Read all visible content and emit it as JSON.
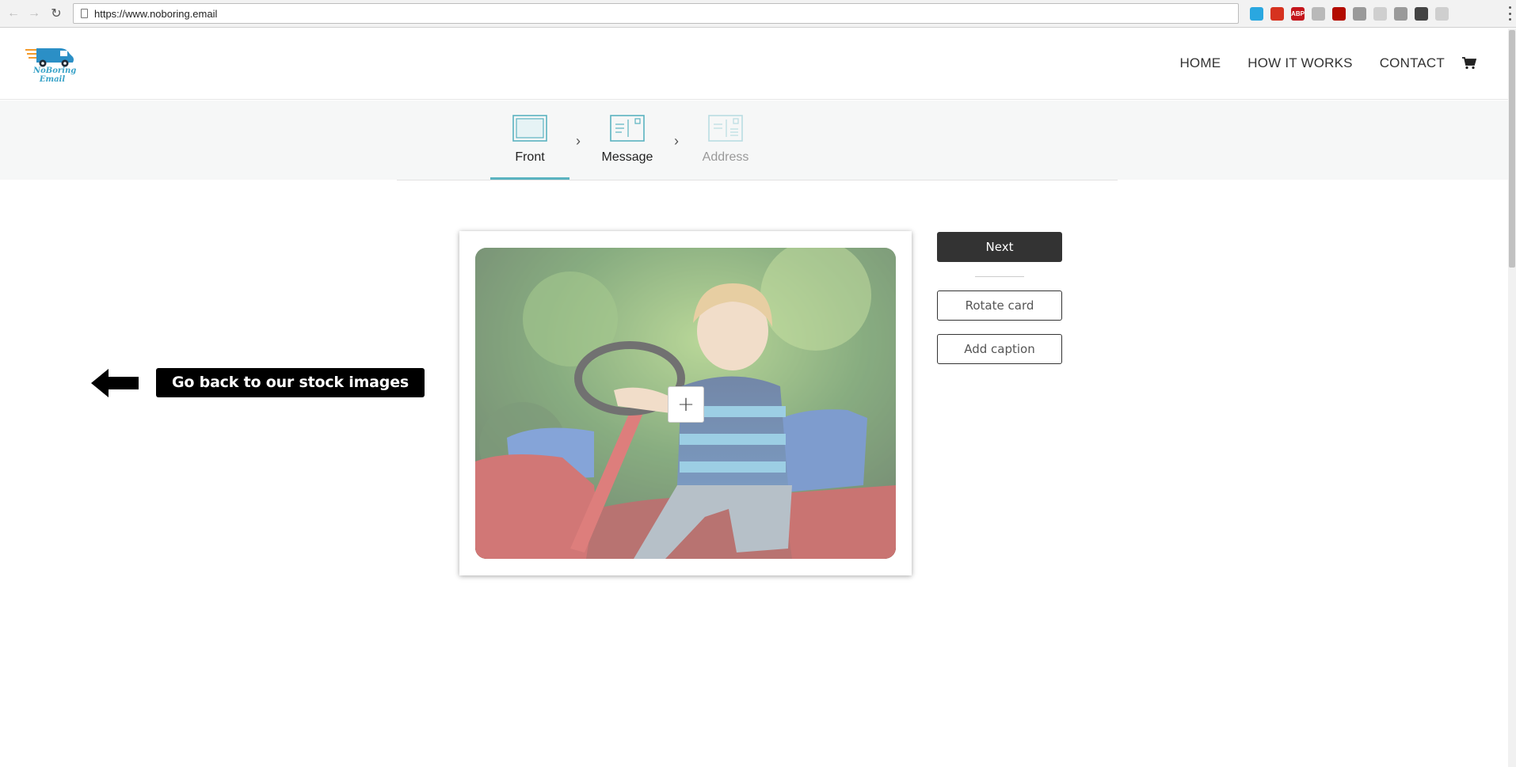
{
  "browser": {
    "url": "https://www.noboring.email",
    "extensions": [
      {
        "name": "sync-icon",
        "color": "#2aa7e0"
      },
      {
        "name": "flash-icon",
        "color": "#d6321f"
      },
      {
        "name": "adblock-icon",
        "color": "#c4161c",
        "label": "ABP"
      },
      {
        "name": "camera-icon",
        "color": "#b9b9b9"
      },
      {
        "name": "acrobat-icon",
        "color": "#b30b00"
      },
      {
        "name": "feather-icon",
        "color": "#9a9a9a"
      },
      {
        "name": "pen-icon",
        "color": "#cfcfcf"
      },
      {
        "name": "magnifier-icon",
        "color": "#9a9a9a"
      },
      {
        "name": "block-icon",
        "color": "#444444"
      },
      {
        "name": "chat-icon",
        "color": "#cfcfcf"
      }
    ]
  },
  "header": {
    "logo_text": "NoBoring Email",
    "nav": [
      {
        "label": "HOME"
      },
      {
        "label": "HOW IT WORKS"
      },
      {
        "label": "CONTACT"
      }
    ]
  },
  "steps": [
    {
      "label": "Front",
      "state": "active"
    },
    {
      "label": "Message",
      "state": "enabled"
    },
    {
      "label": "Address",
      "state": "disabled"
    }
  ],
  "back": {
    "label": "Go back to our stock images"
  },
  "card": {
    "image_subject": "child-on-tractor-photo"
  },
  "actions": {
    "next_label": "Next",
    "rotate_label": "Rotate card",
    "caption_label": "Add caption"
  },
  "colors": {
    "accent": "#5ab3c0",
    "logo_blue": "#3aa3c8",
    "dark_button": "#333333"
  }
}
